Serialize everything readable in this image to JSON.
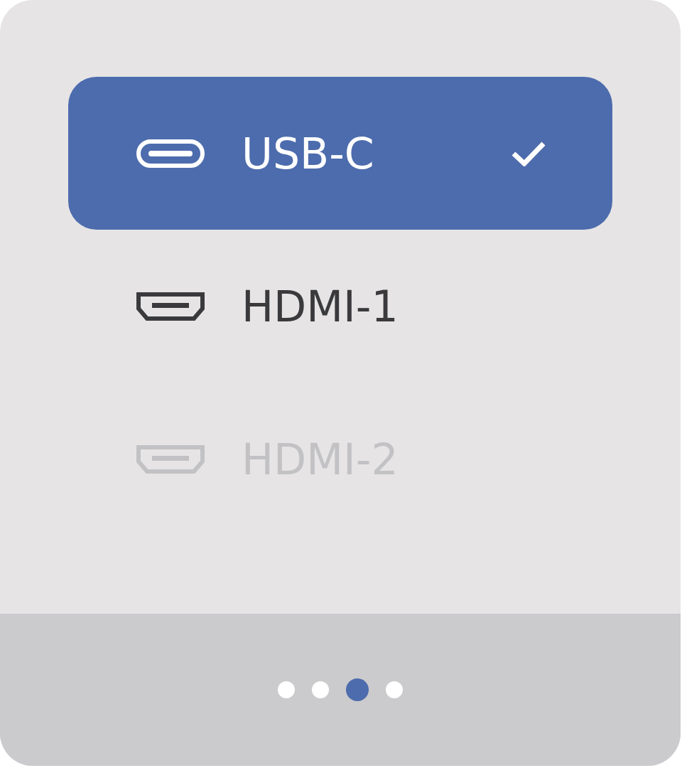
{
  "inputs": [
    {
      "kind": "usb-c",
      "label": "USB-C",
      "selected": true,
      "disabled": false
    },
    {
      "kind": "hdmi",
      "label": "HDMI-1",
      "selected": false,
      "disabled": false
    },
    {
      "kind": "hdmi",
      "label": "HDMI-2",
      "selected": false,
      "disabled": true
    }
  ],
  "pager": [
    {
      "selected": false
    },
    {
      "selected": false
    },
    {
      "selected": true
    },
    {
      "selected": false
    }
  ]
}
